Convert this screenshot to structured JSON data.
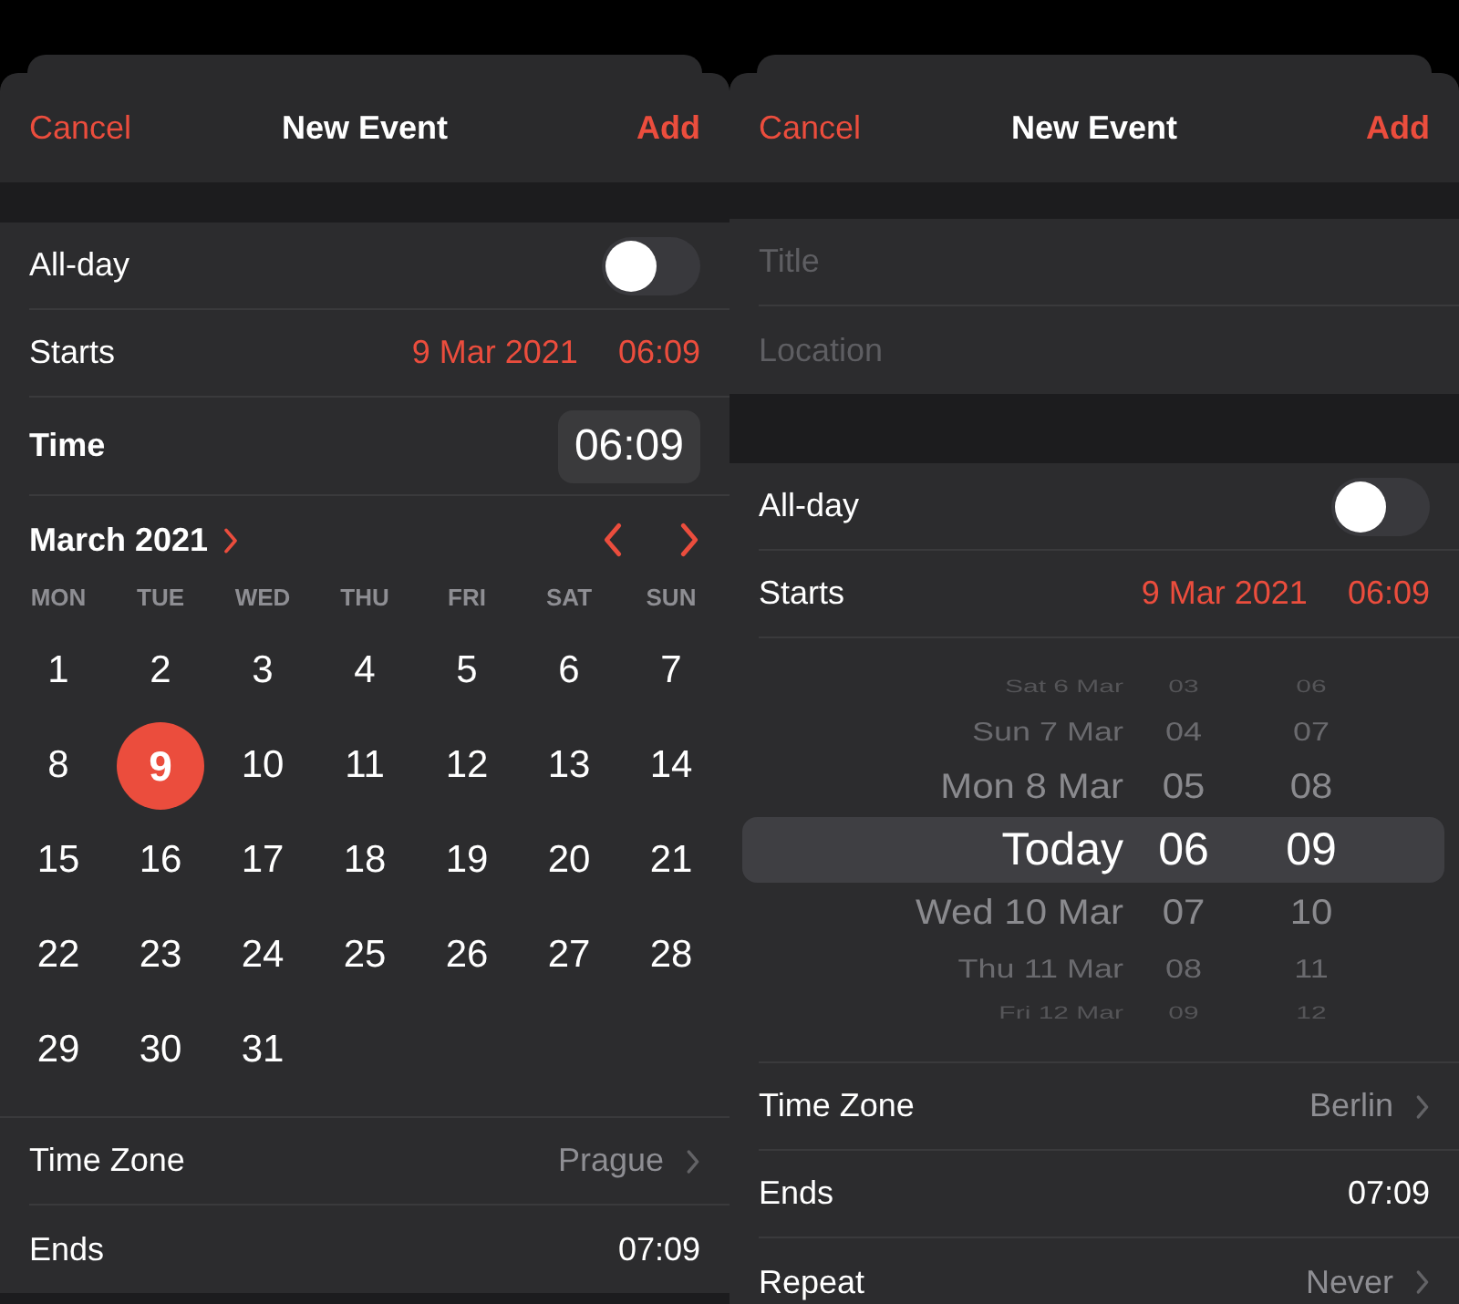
{
  "screens": [
    {
      "nav": {
        "cancel": "Cancel",
        "title": "New Event",
        "add": "Add"
      },
      "groups": [
        [
          {
            "kind": "toggle",
            "label": "All-day",
            "on": false
          },
          {
            "kind": "datetime",
            "label": "Starts",
            "date": "9 Mar 2021",
            "time": "06:09"
          },
          {
            "kind": "time",
            "label": "Time",
            "value": "06:09"
          },
          {
            "kind": "calendar",
            "month": "March 2021",
            "weekdays": [
              "MON",
              "TUE",
              "WED",
              "THU",
              "FRI",
              "SAT",
              "SUN"
            ],
            "days": [
              {
                "label": "1",
                "selected": false
              },
              {
                "label": "2",
                "selected": false
              },
              {
                "label": "3",
                "selected": false
              },
              {
                "label": "4",
                "selected": false
              },
              {
                "label": "5",
                "selected": false
              },
              {
                "label": "6",
                "selected": false
              },
              {
                "label": "7",
                "selected": false
              },
              {
                "label": "8",
                "selected": false
              },
              {
                "label": "9",
                "selected": true
              },
              {
                "label": "10",
                "selected": false
              },
              {
                "label": "11",
                "selected": false
              },
              {
                "label": "12",
                "selected": false
              },
              {
                "label": "13",
                "selected": false
              },
              {
                "label": "14",
                "selected": false
              },
              {
                "label": "15",
                "selected": false
              },
              {
                "label": "16",
                "selected": false
              },
              {
                "label": "17",
                "selected": false
              },
              {
                "label": "18",
                "selected": false
              },
              {
                "label": "19",
                "selected": false
              },
              {
                "label": "20",
                "selected": false
              },
              {
                "label": "21",
                "selected": false
              },
              {
                "label": "22",
                "selected": false
              },
              {
                "label": "23",
                "selected": false
              },
              {
                "label": "24",
                "selected": false
              },
              {
                "label": "25",
                "selected": false
              },
              {
                "label": "26",
                "selected": false
              },
              {
                "label": "27",
                "selected": false
              },
              {
                "label": "28",
                "selected": false
              },
              {
                "label": "29",
                "selected": false
              },
              {
                "label": "30",
                "selected": false
              },
              {
                "label": "31",
                "selected": false
              }
            ]
          },
          {
            "kind": "disclosure",
            "label": "Time Zone",
            "value": "Prague"
          },
          {
            "kind": "value",
            "label": "Ends",
            "value": "07:09"
          }
        ]
      ]
    },
    {
      "nav": {
        "cancel": "Cancel",
        "title": "New Event",
        "add": "Add"
      },
      "groups": [
        [
          {
            "kind": "field",
            "placeholder": "Title"
          },
          {
            "kind": "field",
            "placeholder": "Location"
          }
        ],
        [
          {
            "kind": "toggle",
            "label": "All-day",
            "on": false
          },
          {
            "kind": "datetime",
            "label": "Starts",
            "date": "9 Mar 2021",
            "time": "06:09"
          },
          {
            "kind": "picker",
            "columns": [
              {
                "items": [
                  {
                    "label": "Sat 6 Mar",
                    "selected": false
                  },
                  {
                    "label": "Sun 7 Mar",
                    "selected": false
                  },
                  {
                    "label": "Mon 8 Mar",
                    "selected": false
                  },
                  {
                    "label": "Today",
                    "selected": true
                  },
                  {
                    "label": "Wed 10 Mar",
                    "selected": false
                  },
                  {
                    "label": "Thu 11 Mar",
                    "selected": false
                  },
                  {
                    "label": "Fri 12 Mar",
                    "selected": false
                  }
                ]
              },
              {
                "items": [
                  {
                    "label": "03",
                    "selected": false
                  },
                  {
                    "label": "04",
                    "selected": false
                  },
                  {
                    "label": "05",
                    "selected": false
                  },
                  {
                    "label": "06",
                    "selected": true
                  },
                  {
                    "label": "07",
                    "selected": false
                  },
                  {
                    "label": "08",
                    "selected": false
                  },
                  {
                    "label": "09",
                    "selected": false
                  }
                ]
              },
              {
                "items": [
                  {
                    "label": "06",
                    "selected": false
                  },
                  {
                    "label": "07",
                    "selected": false
                  },
                  {
                    "label": "08",
                    "selected": false
                  },
                  {
                    "label": "09",
                    "selected": true
                  },
                  {
                    "label": "10",
                    "selected": false
                  },
                  {
                    "label": "11",
                    "selected": false
                  },
                  {
                    "label": "12",
                    "selected": false
                  }
                ]
              }
            ]
          },
          {
            "kind": "disclosure",
            "label": "Time Zone",
            "value": "Berlin"
          },
          {
            "kind": "value",
            "label": "Ends",
            "value": "07:09"
          },
          {
            "kind": "disclosure",
            "label": "Repeat",
            "value": "Never"
          }
        ]
      ]
    }
  ]
}
